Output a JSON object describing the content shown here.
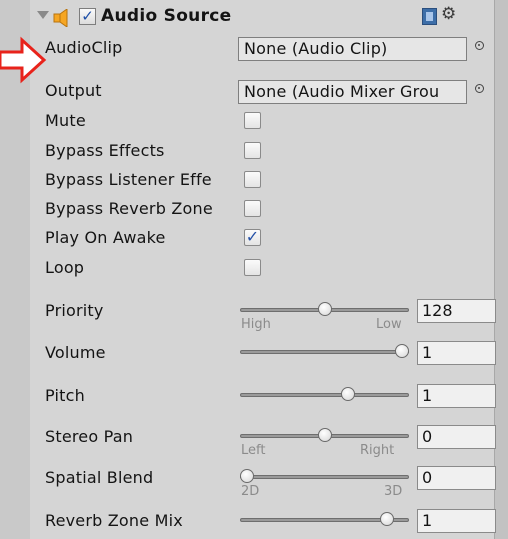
{
  "component": {
    "title": "Audio Source",
    "enabled": true
  },
  "fields": {
    "audio_clip": {
      "label": "AudioClip",
      "value": "None (Audio Clip)"
    },
    "output": {
      "label": "Output",
      "value": "None (Audio Mixer Grou"
    },
    "mute": {
      "label": "Mute",
      "checked": false
    },
    "bypass_effects": {
      "label": "Bypass Effects",
      "checked": false
    },
    "bypass_listener_effects": {
      "label": "Bypass Listener Effe",
      "checked": false
    },
    "bypass_reverb_zones": {
      "label": "Bypass Reverb Zone",
      "checked": false
    },
    "play_on_awake": {
      "label": "Play On Awake",
      "checked": true,
      "mark": "✓"
    },
    "loop": {
      "label": "Loop",
      "checked": false
    },
    "priority": {
      "label": "Priority",
      "value": "128",
      "min_label": "High",
      "max_label": "Low",
      "fraction": 0.5
    },
    "volume": {
      "label": "Volume",
      "value": "1",
      "fraction": 1.0
    },
    "pitch": {
      "label": "Pitch",
      "value": "1",
      "fraction": 0.65
    },
    "stereo_pan": {
      "label": "Stereo Pan",
      "value": "0",
      "min_label": "Left",
      "max_label": "Right",
      "fraction": 0.5
    },
    "spatial_blend": {
      "label": "Spatial Blend",
      "value": "0",
      "min_label": "2D",
      "max_label": "3D",
      "fraction": 0.0
    },
    "reverb_zone_mix": {
      "label": "Reverb Zone Mix",
      "value": "1",
      "fraction": 0.9
    }
  },
  "icons": {
    "foldout": "foldout-triangle-icon",
    "speaker": "speaker-icon",
    "help": "help-book-icon",
    "settings": "gear-icon",
    "picker": "object-picker-icon",
    "annotation": "red-arrow-icon"
  },
  "colors": {
    "annotation_arrow": "#e8231b",
    "speaker": "#f6a623",
    "check": "#2551a8"
  }
}
